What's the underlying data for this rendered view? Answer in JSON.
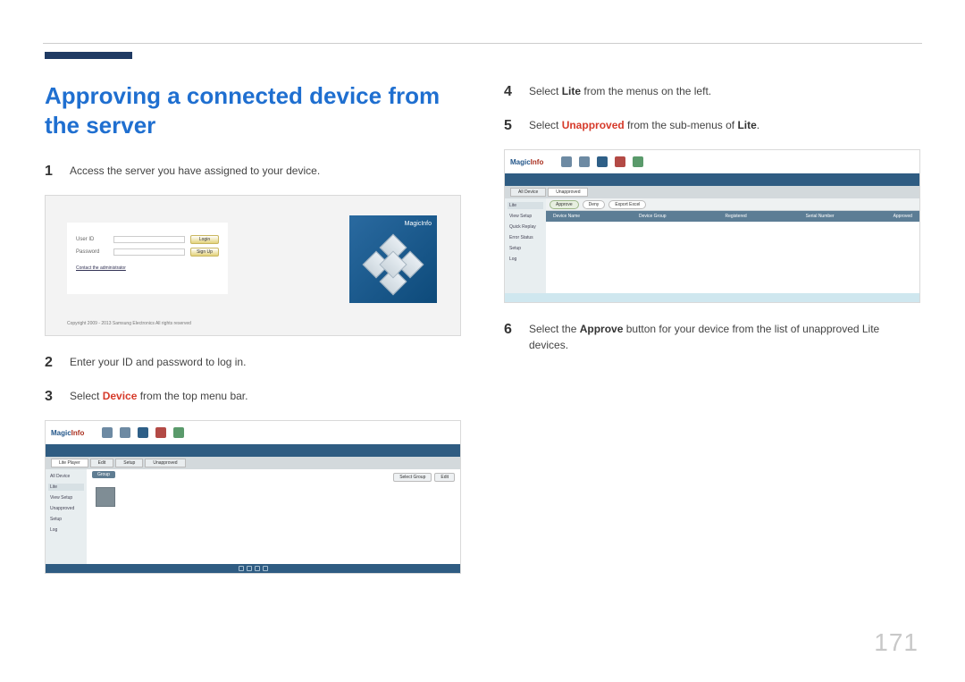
{
  "page_number": "171",
  "heading": "Approving a connected device from the server",
  "steps": {
    "s1": {
      "num": "1",
      "text": "Access the server you have assigned to your device."
    },
    "s2": {
      "num": "2",
      "text": "Enter your ID and password to log in."
    },
    "s3": {
      "num": "3",
      "pre": "Select ",
      "hl": "Device",
      "post": " from the top menu bar."
    },
    "s4": {
      "num": "4",
      "pre": "Select ",
      "hl": "Lite",
      "post": " from the menus on the left."
    },
    "s5": {
      "num": "5",
      "pre": "Select ",
      "hl": "Unapproved",
      "post": " from the sub-menus of ",
      "hl2": "Lite",
      "post2": "."
    },
    "s6": {
      "num": "6",
      "pre": "Select the ",
      "hl": "Approve",
      "post": " button for your device from the list of unapproved Lite devices."
    }
  },
  "login_shot": {
    "user_id_label": "User ID",
    "password_label": "Password",
    "login_btn": "Login",
    "signup_btn": "Sign Up",
    "contact_link": "Contact the administrator",
    "brand": "MagicInfo",
    "copyright": "Copyright 2009 - 2013 Samsung Electronics All rights reserved"
  },
  "app_shot": {
    "brand_m": "Magic",
    "brand_i": "Info",
    "tabs": [
      "Lite Player",
      "Edit",
      "Setup",
      "Unapproved"
    ],
    "sidebar": [
      "All Device",
      "Lite",
      "View Setup",
      "Unapproved",
      "Setup",
      "Log"
    ],
    "thumb_label": "Group",
    "btns": [
      "Select Group",
      "Edit"
    ]
  },
  "unapproved_shot": {
    "pills": [
      "Approve",
      "Deny",
      "Export Excel"
    ],
    "sidebar": [
      "Lite",
      "View Setup",
      "Quick Replay",
      "Error Status",
      "Setup",
      "Log"
    ],
    "tabs_top": [
      "All Device",
      "Unapproved"
    ],
    "columns": [
      "Device Name",
      "Device Group",
      "Registered",
      "Serial Number",
      "Approved"
    ]
  }
}
